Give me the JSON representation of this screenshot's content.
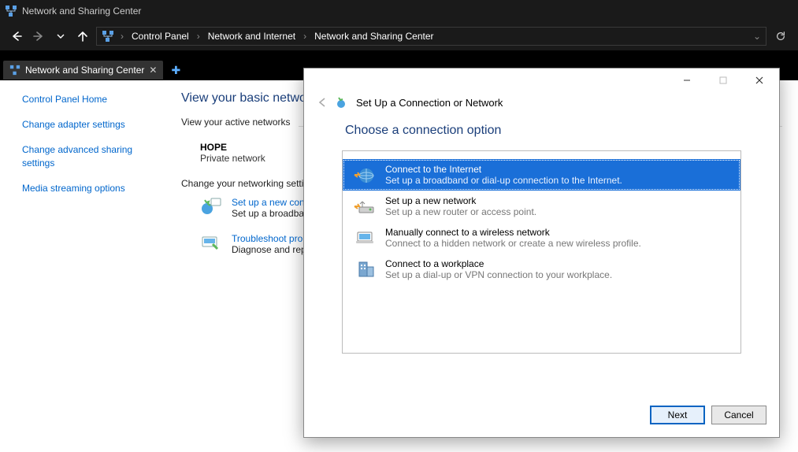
{
  "window_title": "Network and Sharing Center",
  "breadcrumbs": [
    "Control Panel",
    "Network and Internet",
    "Network and Sharing Center"
  ],
  "tab_label": "Network and Sharing Center",
  "sidebar": {
    "items": [
      "Control Panel Home",
      "Change adapter settings",
      "Change advanced sharing settings",
      "Media streaming options"
    ]
  },
  "main": {
    "heading": "View your basic netwo",
    "active_label": "View your active networks",
    "network_name": "HOPE",
    "network_type": "Private network",
    "change_label": "Change your networking setti",
    "setup_link": "Set up a new conne",
    "setup_desc": "Set up a broadband",
    "trouble_link": "Troubleshoot probl",
    "trouble_desc": "Diagnose and repai"
  },
  "dialog": {
    "title": "Set Up a Connection or Network",
    "heading": "Choose a connection option",
    "options": [
      {
        "title": "Connect to the Internet",
        "desc": "Set up a broadband or dial-up connection to the Internet.",
        "selected": true
      },
      {
        "title": "Set up a new network",
        "desc": "Set up a new router or access point.",
        "selected": false
      },
      {
        "title": "Manually connect to a wireless network",
        "desc": "Connect to a hidden network or create a new wireless profile.",
        "selected": false
      },
      {
        "title": "Connect to a workplace",
        "desc": "Set up a dial-up or VPN connection to your workplace.",
        "selected": false
      }
    ],
    "next": "Next",
    "cancel": "Cancel"
  }
}
